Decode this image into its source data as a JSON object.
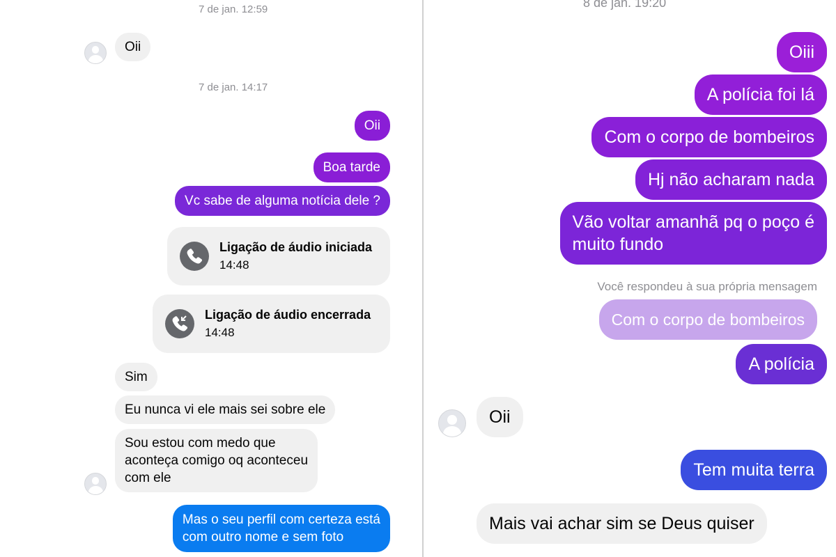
{
  "left": {
    "timestamp_1": "7 de jan. 12:59",
    "timestamp_2": "7 de jan. 14:17",
    "messages": {
      "in_oii": "Oii",
      "out_oii": "Oii",
      "out_boa_tarde": "Boa tarde",
      "out_noticia": "Vc sabe de alguma notícia dele ?",
      "in_sim": "Sim",
      "in_nunca": "Eu nunca vi ele mais sei sobre ele",
      "in_medo": "Sou estou com medo que\naconteça comigo oq aconteceu\ncom ele",
      "out_perfil": "Mas o seu perfil com certeza está\ncom outro nome e sem foto"
    },
    "call_started": {
      "title": "Ligação de áudio iniciada",
      "time": "14:48",
      "icon": "phone-icon"
    },
    "call_ended": {
      "title": "Ligação de áudio encerrada",
      "time": "14:48",
      "icon": "phone-incoming-icon"
    }
  },
  "right": {
    "timestamp_1": "8 de jan. 19:20",
    "messages": {
      "out_oiii": "Oiii",
      "out_policia_foi": "A polícia foi lá",
      "out_bombeiros": "Com o corpo de bombeiros",
      "out_nada": "Hj não acharam nada",
      "out_voltar": "Vão voltar amanhã pq o poço é\nmuito fundo",
      "reply_note": "Você respondeu à sua própria mensagem",
      "quoted": "Com o corpo de bombeiros",
      "out_a_policia": "A polícia",
      "in_oii": "Oii",
      "out_terra": "Tem muita terra",
      "in_deus": "Mais vai achar sim se Deus quiser"
    }
  },
  "colors": {
    "incoming_bg": "#f0f0f0",
    "outgoing_purple": "#8a1ed6",
    "outgoing_violet": "#6a2fd4",
    "outgoing_blue": "#3a4ee0",
    "outgoing_bright_blue": "#0a7cf0",
    "quoted_bg": "#c7a6ec",
    "timestamp_text": "#8e8e93"
  }
}
